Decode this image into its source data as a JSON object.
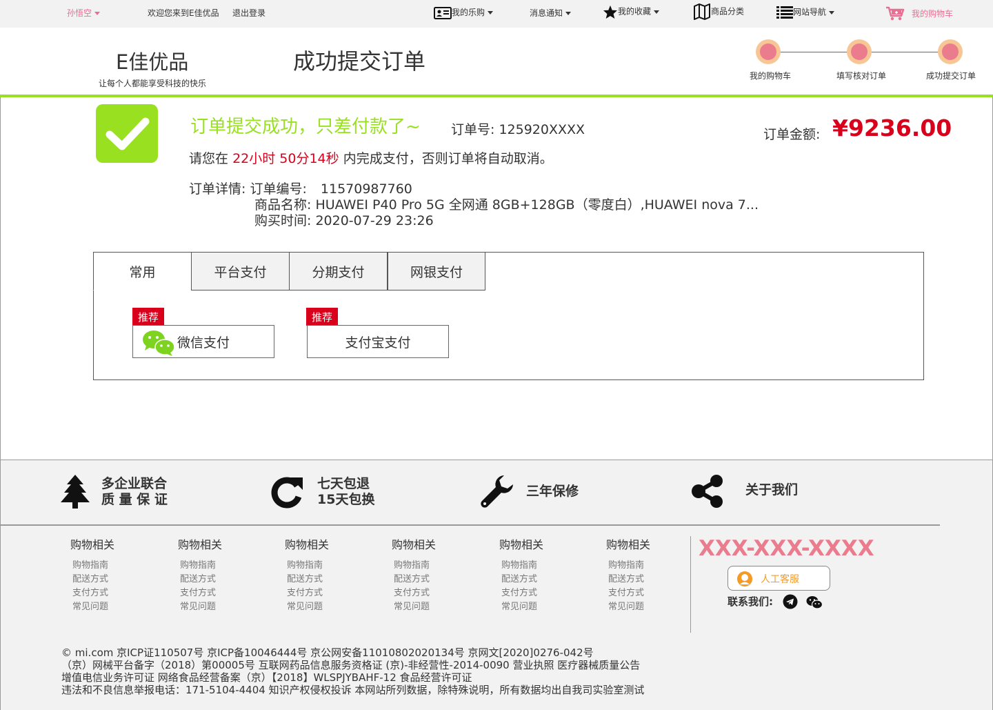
{
  "topbar": {
    "username": "孙悟空",
    "welcome": "欢迎您来到E佳优品",
    "logout": "退出登录",
    "my_lego": "我的乐购",
    "messages": "消息通知",
    "favorites": "我的收藏",
    "categories": "商品分类",
    "site_nav": "网站导航",
    "cart": "我的购物车"
  },
  "header": {
    "logo": "E佳优品",
    "slogan": "让每个人都能享受科技的快乐",
    "page_title": "成功提交订单",
    "steps": [
      "我的购物车",
      "填写核对订单",
      "成功提交订单"
    ]
  },
  "order": {
    "success_title": "订单提交成功，只差付款了~",
    "order_no_label": "订单号:",
    "order_no": "125920XXXX",
    "amount_label": "订单金额:",
    "amount": "¥9236.00",
    "notice_prefix": "请您在",
    "time_left": "22小时 50分14秒",
    "notice_suffix": "内完成支付，否则订单将自动取消。",
    "detail_label": "订单详情:",
    "detail_no_label": "订单编号:",
    "detail_no": "11570987760",
    "product_label": "商品名称:",
    "product": "HUAWEI P40 Pro 5G 全网通 8GB+128GB（零度白）,HUAWEI nova 7...",
    "time_label": "购买时间:",
    "time": "2020-07-29 23:26"
  },
  "payment": {
    "tabs": [
      "常用",
      "平台支付",
      "分期支付",
      "网银支付"
    ],
    "active_tab": "常用",
    "badge": "推荐",
    "wechat": "微信支付",
    "alipay": "支付宝支付"
  },
  "footer": {
    "services": [
      {
        "line1": "多企业联合",
        "line2": "质 量 保 证",
        "icon": "tree-icon"
      },
      {
        "line1": "七天包退",
        "line2": "15天包换",
        "icon": "refresh-icon"
      },
      {
        "line1": "三年保修",
        "line2": "",
        "icon": "wrench-icon"
      },
      {
        "line1": "关于我们",
        "line2": "",
        "icon": "share-icon"
      }
    ],
    "columns": [
      {
        "title": "购物相关",
        "links": [
          "购物指南",
          "配送方式",
          "支付方式",
          "常见问题"
        ]
      },
      {
        "title": "购物相关",
        "links": [
          "购物指南",
          "配送方式",
          "支付方式",
          "常见问题"
        ]
      },
      {
        "title": "购物相关",
        "links": [
          "购物指南",
          "配送方式",
          "支付方式",
          "常见问题"
        ]
      },
      {
        "title": "购物相关",
        "links": [
          "购物指南",
          "配送方式",
          "支付方式",
          "常见问题"
        ]
      },
      {
        "title": "购物相关",
        "links": [
          "购物指南",
          "配送方式",
          "支付方式",
          "常见问题"
        ]
      },
      {
        "title": "购物相关",
        "links": [
          "购物指南",
          "配送方式",
          "支付方式",
          "常见问题"
        ]
      }
    ],
    "phone": "XXX-XXX-XXXX",
    "service_btn": "人工客服",
    "contact_label": "联系我们:",
    "legal": [
      "© mi.com 京ICP证110507号 京ICP备10046444号 京公网安备11010802020134号 京网文[2020]0276-042号",
      "（京）网械平台备字（2018）第00005号 互联网药品信息服务资格证 (京)-非经营性-2014-0090 营业执照 医疗器械质量公告",
      "增值电信业务许可证 网络食品经营备案（京）【2018】WLSPJYBAHF-12  食品经营许可证",
      "违法和不良信息举报电话：171-5104-4404 知识产权侵权投诉 本网站所列数据，除特殊说明，所有数据均出自我司实验室测试"
    ]
  },
  "colors": {
    "green": "#99e021",
    "red": "#d9001b",
    "pink": "#e86e93",
    "phone_pink": "#ea7c8e",
    "orange": "#f59a23"
  }
}
